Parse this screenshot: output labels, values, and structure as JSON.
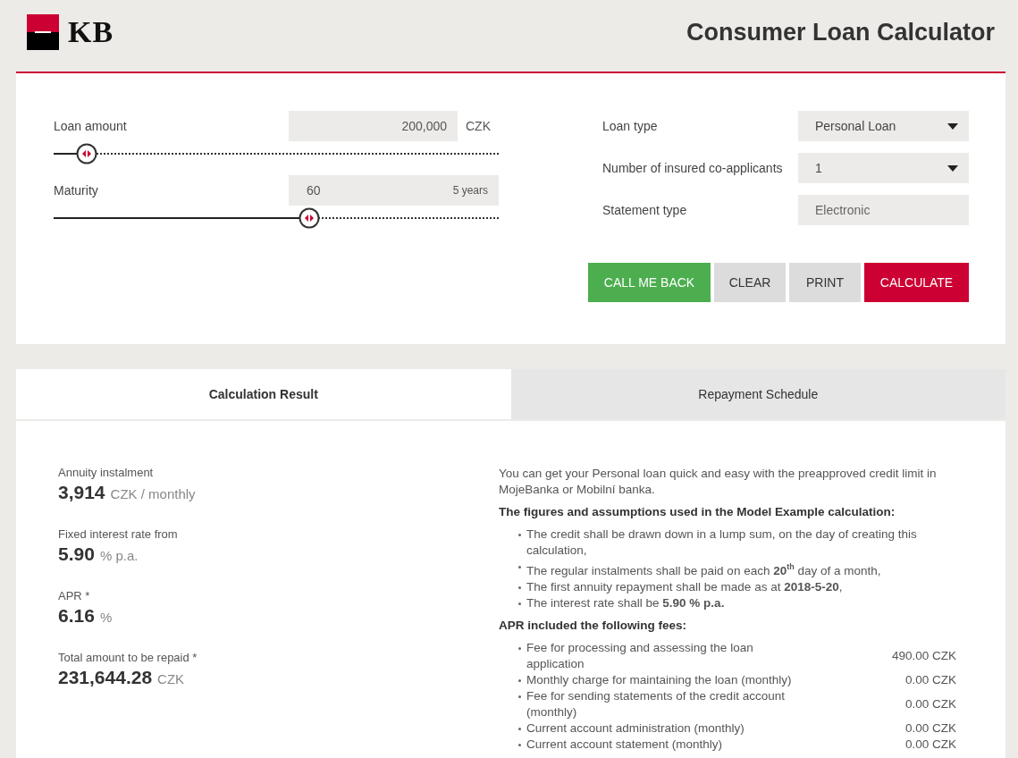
{
  "header": {
    "logo_text": "KB",
    "title": "Consumer Loan Calculator"
  },
  "sliders": [
    {
      "label": "Loan amount",
      "value": "200,000",
      "unit": "CZK",
      "level": 0.074
    },
    {
      "label": "Maturity",
      "value": "60",
      "hint": "5 years",
      "level": 0.574
    }
  ],
  "selects": [
    {
      "kind": "dropdown",
      "label": "Loan type",
      "value": "Personal Loan"
    },
    {
      "kind": "dropdown",
      "label": "Number of insured co-applicants",
      "value": "1"
    },
    {
      "kind": "readonly",
      "label": "Statement type",
      "value": "Electronic"
    }
  ],
  "buttons": [
    {
      "kind": "success",
      "label": "CALL ME BACK"
    },
    {
      "kind": "neutral",
      "label": "CLEAR"
    },
    {
      "kind": "neutral",
      "label": "PRINT"
    },
    {
      "kind": "primary",
      "label": "CALCULATE"
    }
  ],
  "tabs": [
    {
      "label": "Calculation Result",
      "selected": true
    },
    {
      "label": "Repayment Schedule",
      "selected": false
    }
  ],
  "results": [
    {
      "label": "Annuity instalment",
      "value": "3,914",
      "unit": "CZK / monthly"
    },
    {
      "label": "Fixed interest rate from",
      "value": "5.90",
      "unit": "% p.a."
    },
    {
      "label": "APR *",
      "value": "6.16",
      "unit": "%"
    },
    {
      "label": "Total amount to be repaid *",
      "value": "231,644.28",
      "unit": "CZK"
    }
  ],
  "info": {
    "intro": "You can get your Personal loan quick and easy with the preapproved credit limit in MojeBanka or Mobilní banka.",
    "assumptions_heading": "The figures and assumptions used in the Model Example calculation:",
    "assumptions": [
      "The credit shall be drawn down in a lump sum, on the day of creating this calculation,",
      "The regular instalments shall be paid on each **20**$^{th}$ day of a month,",
      "The first annuity repayment shall be made as at **2018-5-20**,",
      "The interest rate shall be **5.90 % p.a.**"
    ],
    "fees_heading": "APR included the following fees:",
    "fees": [
      {
        "name": "Fee for processing and assessing the loan application",
        "amount": "490.00 CZK"
      },
      {
        "name": "Monthly charge for maintaining the loan (monthly)",
        "amount": "0.00 CZK"
      },
      {
        "name": "Fee for sending statements of the credit account (monthly)",
        "amount": "0.00 CZK"
      },
      {
        "name": "Current account administration (monthly)",
        "amount": "0.00 CZK"
      },
      {
        "name": "Current account statement (monthly)",
        "amount": "0.00 CZK"
      }
    ]
  }
}
